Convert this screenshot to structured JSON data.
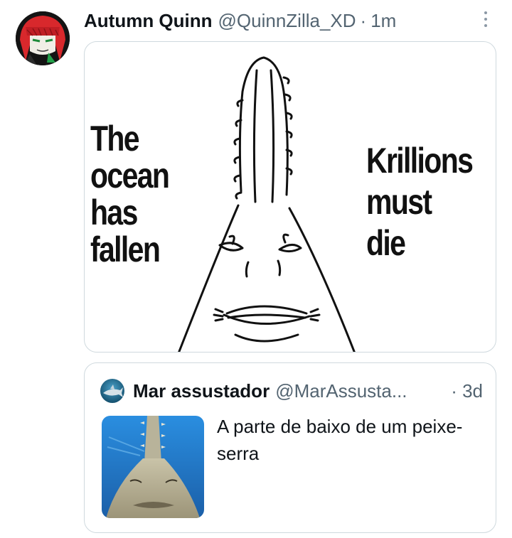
{
  "post": {
    "author_name": "Autumn Quinn",
    "author_handle": "@QuinnZilla_XD",
    "separator": "·",
    "time": "1m",
    "more_icon": "more-options-icon"
  },
  "meme": {
    "left_lines": [
      "The",
      "ocean",
      "has",
      "fallen"
    ],
    "right_lines": [
      "Krillions",
      "must",
      "die"
    ]
  },
  "quote": {
    "author_name": "Mar assustador",
    "author_handle": "@MarAssusta...",
    "time": "· 3d",
    "text": "A parte de baixo de um peixe-serra"
  },
  "colors": {
    "secondary_text": "#536471",
    "border": "#cfd9de",
    "ocean_blue": "#2f86d6"
  }
}
